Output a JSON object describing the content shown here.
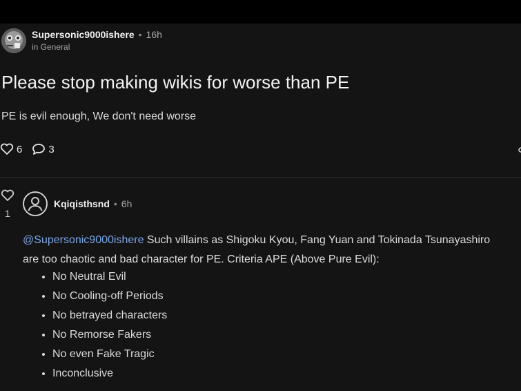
{
  "post": {
    "author": "Supersonic9000ishere",
    "separator": "•",
    "time": "16h",
    "community": "in General",
    "title": "Please stop making wikis for worse than PE",
    "body": "PE is evil enough, We don't need worse",
    "likes": "6",
    "comments": "3"
  },
  "comment": {
    "votes": "1",
    "author": "Kqiqisthsnd",
    "separator": "•",
    "time": "6h",
    "mention": "@Supersonic9000ishere",
    "text_line1": " Such villains as Shigoku Kyou, Fang Yuan and Tokinada Tsunayashiro",
    "text_line2": "are too chaotic and bad character for PE. Criteria APE (Above Pure Evil):",
    "criteria": [
      "No Neutral Evil",
      "No Cooling-off Periods",
      "No betrayed characters",
      "No Remorse Fakers",
      "No even Fake Tragic",
      "Inconclusive"
    ]
  },
  "icons": {
    "like": "heart-icon",
    "comment": "speech-bubble-icon",
    "avatar_default": "user-icon"
  },
  "colors": {
    "background": "#141414",
    "mention": "#7aa7e8",
    "text": "#e6e6e6"
  }
}
